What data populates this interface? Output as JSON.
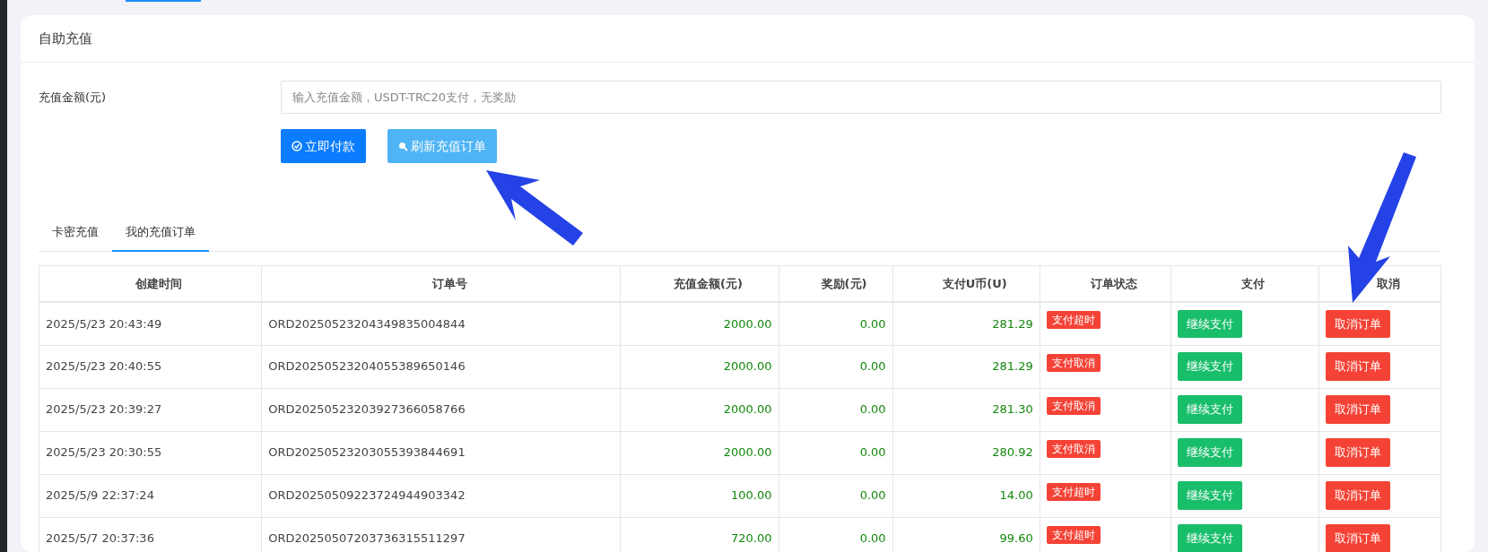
{
  "card": {
    "title": "自助充值"
  },
  "form": {
    "label": "充值金额(元)",
    "placeholder": "输入充值金额，USDT-TRC20支付，无奖励"
  },
  "buttons": [
    {
      "kind": "primary",
      "label": "立即付款"
    },
    {
      "kind": "info",
      "label": "刷新充值订单"
    }
  ],
  "tabs": [
    {
      "label": "卡密充值",
      "selected": false
    },
    {
      "label": "我的充值订单",
      "selected": true
    }
  ],
  "table": {
    "columns": [
      "创建时间",
      "订单号",
      "充值金额(元)",
      "奖励(元)",
      "支付U币(U)",
      "订单状态",
      "支付",
      "取消"
    ],
    "rows": [
      {
        "time": "2025/5/23 20:43:49",
        "order": "ORD20250523204349835004844",
        "amount": "2000.00",
        "bonus": "0.00",
        "usdt": "281.29",
        "status": "支付超时",
        "pay": "继续支付",
        "cancel": "取消订单"
      },
      {
        "time": "2025/5/23 20:40:55",
        "order": "ORD20250523204055389650146",
        "amount": "2000.00",
        "bonus": "0.00",
        "usdt": "281.29",
        "status": "支付取消",
        "pay": "继续支付",
        "cancel": "取消订单"
      },
      {
        "time": "2025/5/23 20:39:27",
        "order": "ORD20250523203927366058766",
        "amount": "2000.00",
        "bonus": "0.00",
        "usdt": "281.30",
        "status": "支付取消",
        "pay": "继续支付",
        "cancel": "取消订单"
      },
      {
        "time": "2025/5/23 20:30:55",
        "order": "ORD20250523203055393844691",
        "amount": "2000.00",
        "bonus": "0.00",
        "usdt": "280.92",
        "status": "支付取消",
        "pay": "继续支付",
        "cancel": "取消订单"
      },
      {
        "time": "2025/5/9 22:37:24",
        "order": "ORD20250509223724944903342",
        "amount": "100.00",
        "bonus": "0.00",
        "usdt": "14.00",
        "status": "支付超时",
        "pay": "继续支付",
        "cancel": "取消订单"
      },
      {
        "time": "2025/5/7 20:37:36",
        "order": "ORD20250507203736315511297",
        "amount": "720.00",
        "bonus": "0.00",
        "usdt": "99.60",
        "status": "支付超时",
        "pay": "继续支付",
        "cancel": "取消订单"
      }
    ]
  }
}
